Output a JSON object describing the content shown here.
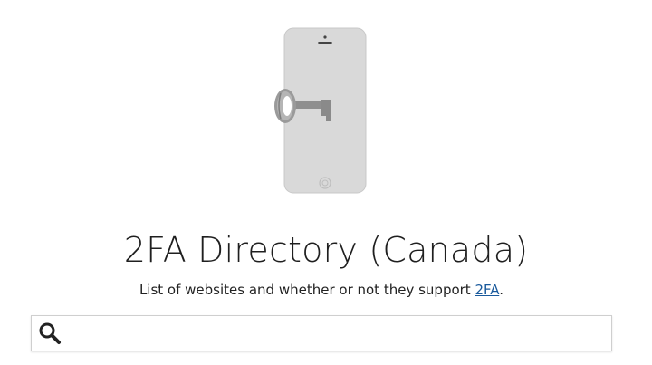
{
  "header": {
    "title": "2FA Directory (Canada)",
    "subtitle_prefix": "List of websites and whether or not they support ",
    "subtitle_link": "2FA",
    "subtitle_suffix": "."
  },
  "logo": {
    "icon": "phone-key-icon",
    "colors": {
      "phone": "#d9d9d9",
      "key": "#8f8f8f"
    }
  },
  "search": {
    "icon": "search-icon",
    "value": "",
    "placeholder": ""
  }
}
